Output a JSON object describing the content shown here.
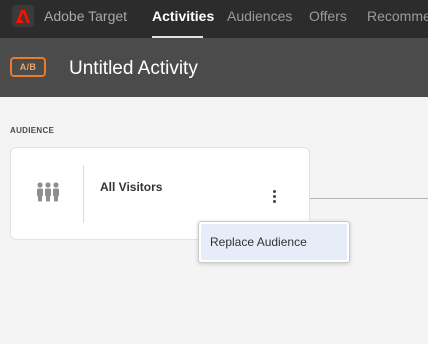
{
  "nav": {
    "app_name": "Adobe Target",
    "items": [
      {
        "label": "Activities",
        "active": true
      },
      {
        "label": "Audiences",
        "active": false
      },
      {
        "label": "Offers",
        "active": false
      },
      {
        "label": "Recommen",
        "active": false
      }
    ],
    "logo_color": "#fa0f00"
  },
  "activity": {
    "type_badge": "A/B",
    "title": "Untitled Activity",
    "badge_color": "#e97b2b"
  },
  "audience_section": {
    "label": "AUDIENCE",
    "card": {
      "name": "All Visitors",
      "icon": "people-group-icon",
      "menu_icon": "more-vertical-icon"
    }
  },
  "context_menu": {
    "items": [
      {
        "label": "Replace Audience",
        "highlighted": true
      }
    ]
  }
}
